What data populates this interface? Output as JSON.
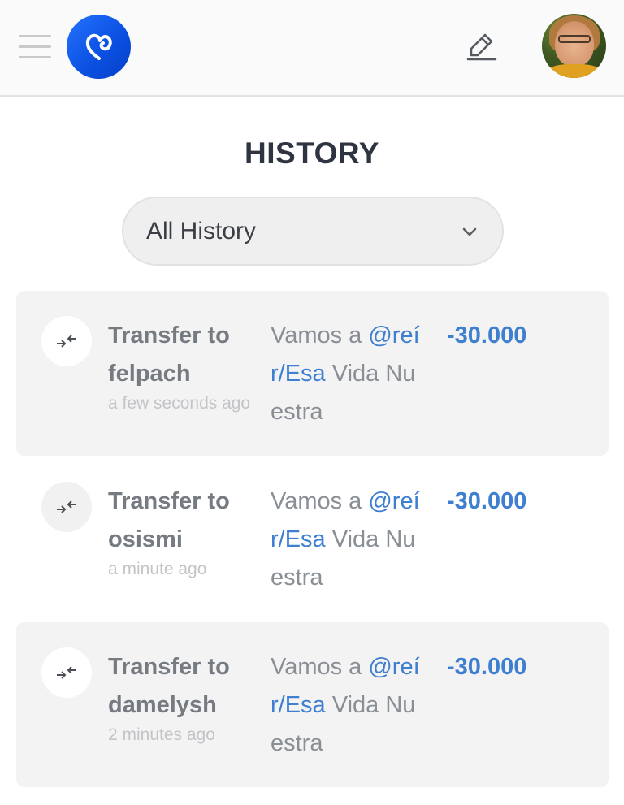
{
  "header": {
    "menu_icon": "hamburger-icon",
    "logo_icon": "heart-logo-icon",
    "edit_icon": "pencil-icon",
    "avatar_icon": "user-avatar",
    "brand_color": "#0a4fe0"
  },
  "page": {
    "title": "HISTORY"
  },
  "filter": {
    "selected": "All History",
    "chevron_icon": "chevron-down-icon"
  },
  "transactions": [
    {
      "title_line1": "Transfer to",
      "title_line2": "felpach",
      "time": "a few seconds ago",
      "memo_prefix": "Vamos a ",
      "memo_mention_a": "@reí",
      "memo_mention_b": "r/Esa",
      "memo_suffix": " Vida Nu",
      "memo_end": "estra",
      "amount": "-30.000",
      "icon": "transfer-arrows-icon"
    },
    {
      "title_line1": "Transfer to",
      "title_line2": "osismi",
      "time": "a minute ago",
      "memo_prefix": "Vamos a ",
      "memo_mention_a": "@reí",
      "memo_mention_b": "r/Esa",
      "memo_suffix": " Vida Nu",
      "memo_end": "estra",
      "amount": "-30.000",
      "icon": "transfer-arrows-icon"
    },
    {
      "title_line1": "Transfer to",
      "title_line2": "damelysh",
      "time": "2 minutes ago",
      "memo_prefix": "Vamos a ",
      "memo_mention_a": "@reí",
      "memo_mention_b": "r/Esa",
      "memo_suffix": " Vida Nu",
      "memo_end": "estra",
      "amount": "-30.000",
      "icon": "transfer-arrows-icon"
    }
  ],
  "colors": {
    "amount": "#3f7fd0",
    "mention": "#3f7fd0",
    "card_bg": "#f3f3f3"
  }
}
